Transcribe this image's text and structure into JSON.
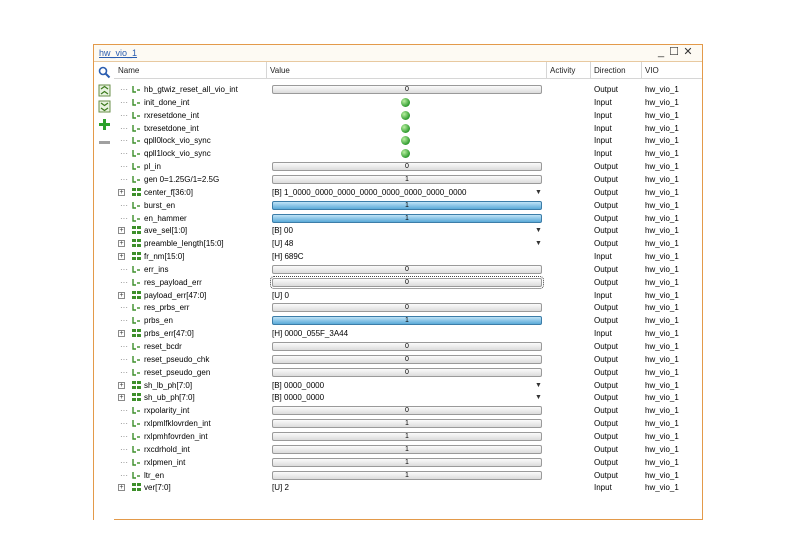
{
  "window": {
    "title": "hw_vio_1",
    "minimize": "_",
    "maximize": "☐",
    "close": "✕"
  },
  "toolbar": {
    "items": [
      "search-icon",
      "collapse-all-icon",
      "expand-all-icon",
      "add-icon",
      "remove-icon"
    ]
  },
  "columns": {
    "name": "Name",
    "value": "Value",
    "activity": "Activity",
    "direction": "Direction",
    "vio": "VIO"
  },
  "colors": {
    "window_border": "#e39a4a",
    "toggle_on": "#5aaad8",
    "led_on": "#2e9a2e",
    "title_link": "#2a5db0"
  },
  "rows": [
    {
      "name": "hb_gtwiz_reset_all_vio_int",
      "kind": "bar",
      "value": "0",
      "on": false,
      "dir": "Output",
      "vio": "hw_vio_1"
    },
    {
      "name": "init_done_int",
      "kind": "led",
      "value": "",
      "dir": "Input",
      "vio": "hw_vio_1"
    },
    {
      "name": "rxresetdone_int",
      "kind": "led",
      "value": "",
      "dir": "Input",
      "vio": "hw_vio_1"
    },
    {
      "name": "txresetdone_int",
      "kind": "led",
      "value": "",
      "dir": "Input",
      "vio": "hw_vio_1"
    },
    {
      "name": "qpll0lock_vio_sync",
      "kind": "led",
      "value": "",
      "dir": "Input",
      "vio": "hw_vio_1"
    },
    {
      "name": "qpll1lock_vio_sync",
      "kind": "led",
      "value": "",
      "dir": "Input",
      "vio": "hw_vio_1"
    },
    {
      "name": "pl_in",
      "kind": "bar",
      "value": "0",
      "on": false,
      "dir": "Output",
      "vio": "hw_vio_1"
    },
    {
      "name": "gen 0=1.25G/1=2.5G",
      "kind": "bar",
      "value": "1",
      "on": false,
      "dir": "Output",
      "vio": "hw_vio_1"
    },
    {
      "name": "center_f[36:0]",
      "kind": "dropdown",
      "value": "[B] 1_0000_0000_0000_0000_0000_0000_0000_0000",
      "expand": true,
      "dir": "Output",
      "vio": "hw_vio_1"
    },
    {
      "name": "burst_en",
      "kind": "bar",
      "value": "1",
      "on": true,
      "dir": "Output",
      "vio": "hw_vio_1"
    },
    {
      "name": "en_hammer",
      "kind": "bar",
      "value": "1",
      "on": true,
      "dir": "Output",
      "vio": "hw_vio_1"
    },
    {
      "name": "ave_sel[1:0]",
      "kind": "dropdown",
      "value": "[B] 00",
      "expand": true,
      "dir": "Output",
      "vio": "hw_vio_1"
    },
    {
      "name": "preamble_length[15:0]",
      "kind": "dropdown",
      "value": "[U] 48",
      "expand": true,
      "dir": "Output",
      "vio": "hw_vio_1"
    },
    {
      "name": "fr_nm[15:0]",
      "kind": "text",
      "value": "[H] 689C",
      "expand": true,
      "dir": "Input",
      "vio": "hw_vio_1"
    },
    {
      "name": "err_ins",
      "kind": "bar",
      "value": "0",
      "on": false,
      "dir": "Output",
      "vio": "hw_vio_1"
    },
    {
      "name": "res_payload_err",
      "kind": "bar",
      "value": "0",
      "on": false,
      "focus": true,
      "dir": "Output",
      "vio": "hw_vio_1"
    },
    {
      "name": "payload_err[47:0]",
      "kind": "text",
      "value": "[U] 0",
      "expand": true,
      "dir": "Input",
      "vio": "hw_vio_1"
    },
    {
      "name": "res_prbs_err",
      "kind": "bar",
      "value": "0",
      "on": false,
      "dir": "Output",
      "vio": "hw_vio_1"
    },
    {
      "name": "prbs_en",
      "kind": "bar",
      "value": "1",
      "on": true,
      "dir": "Output",
      "vio": "hw_vio_1"
    },
    {
      "name": "prbs_err[47:0]",
      "kind": "text",
      "value": "[H] 0000_055F_3A44",
      "expand": true,
      "dir": "Input",
      "vio": "hw_vio_1"
    },
    {
      "name": "reset_bcdr",
      "kind": "bar",
      "value": "0",
      "on": false,
      "dir": "Output",
      "vio": "hw_vio_1"
    },
    {
      "name": "reset_pseudo_chk",
      "kind": "bar",
      "value": "0",
      "on": false,
      "dir": "Output",
      "vio": "hw_vio_1"
    },
    {
      "name": "reset_pseudo_gen",
      "kind": "bar",
      "value": "0",
      "on": false,
      "dir": "Output",
      "vio": "hw_vio_1"
    },
    {
      "name": "sh_lb_ph[7:0]",
      "kind": "dropdown",
      "value": "[B] 0000_0000",
      "expand": true,
      "dir": "Output",
      "vio": "hw_vio_1"
    },
    {
      "name": "sh_ub_ph[7:0]",
      "kind": "dropdown",
      "value": "[B] 0000_0000",
      "expand": true,
      "dir": "Output",
      "vio": "hw_vio_1"
    },
    {
      "name": "rxpolarity_int",
      "kind": "bar",
      "value": "0",
      "on": false,
      "dir": "Output",
      "vio": "hw_vio_1"
    },
    {
      "name": "rxlpmlfklovrden_int",
      "kind": "bar",
      "value": "1",
      "on": false,
      "dir": "Output",
      "vio": "hw_vio_1"
    },
    {
      "name": "rxlpmhfovrden_int",
      "kind": "bar",
      "value": "1",
      "on": false,
      "dir": "Output",
      "vio": "hw_vio_1"
    },
    {
      "name": "rxcdrhold_int",
      "kind": "bar",
      "value": "1",
      "on": false,
      "dir": "Output",
      "vio": "hw_vio_1"
    },
    {
      "name": "rxlpmen_int",
      "kind": "bar",
      "value": "1",
      "on": false,
      "dir": "Output",
      "vio": "hw_vio_1"
    },
    {
      "name": "ltr_en",
      "kind": "bar",
      "value": "1",
      "on": false,
      "dir": "Output",
      "vio": "hw_vio_1"
    },
    {
      "name": "ver[7:0]",
      "kind": "text",
      "value": "[U] 2",
      "expand": true,
      "dir": "Input",
      "vio": "hw_vio_1"
    }
  ]
}
